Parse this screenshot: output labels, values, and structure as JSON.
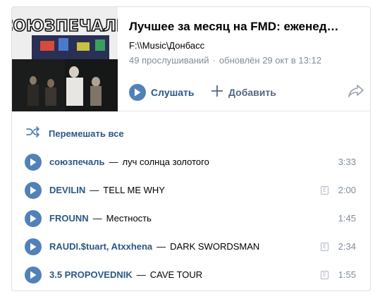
{
  "playlist": {
    "cover_title_art": "СОЮЗПЕЧАЛЬ",
    "title": "Лучшее за месяц на FMD: еженед…",
    "path": "F:\\\\Music\\Донбасс",
    "plays": "49 прослушиваний",
    "updated": "обновлён 29 окт в 13:12",
    "play_label": "Слушать",
    "add_label": "Добавить"
  },
  "shuffle_label": "Перемешать все",
  "tracks": [
    {
      "artist": "союзпечаль",
      "title": "луч солнца золотого",
      "explicit": false,
      "duration": "3:33"
    },
    {
      "artist": "DEVILIN",
      "title": "TELL ME WHY",
      "explicit": true,
      "duration": "2:00"
    },
    {
      "artist": "FROUNN",
      "title": "Местность",
      "explicit": false,
      "duration": "1:45"
    },
    {
      "artist": "RAUDI.$tuart, Atxxhena",
      "title": "DARK SWORDSMAN",
      "explicit": true,
      "duration": "2:34"
    },
    {
      "artist": "3.5 PROPOVEDNIK",
      "title": "CAVE TOUR",
      "explicit": true,
      "duration": "1:55"
    }
  ],
  "explicit_mark": "E",
  "separator": "—",
  "icons": {
    "play": "play-icon",
    "add": "plus-icon",
    "share": "share-arrow-icon",
    "shuffle": "shuffle-icon"
  },
  "colors": {
    "accent": "#5181b8",
    "link": "#2a5885",
    "muted": "#818c99"
  }
}
